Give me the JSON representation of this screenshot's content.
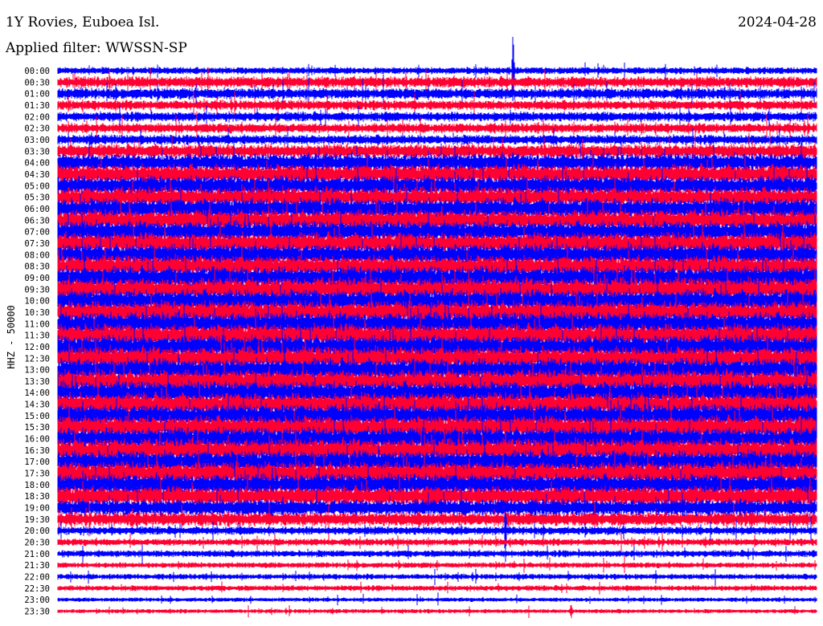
{
  "header": {
    "station": "1Y Rovies, Euboea Isl.",
    "filter": "Applied filter: WWSSN-SP",
    "date": "2024-04-28"
  },
  "chart_data": {
    "type": "line",
    "title": "1Y Rovies, Euboea Isl.",
    "subtitle": "Applied filter: WWSSN-SP",
    "ylabel": "HHZ - 50000",
    "xlabel": "",
    "x_minutes_per_line": 30,
    "colors": [
      "#0000ff",
      "#ff0033"
    ],
    "rows": [
      {
        "label": "00:00",
        "amp": 5
      },
      {
        "label": "00:30",
        "amp": 8
      },
      {
        "label": "01:00",
        "amp": 8
      },
      {
        "label": "01:30",
        "amp": 7
      },
      {
        "label": "02:00",
        "amp": 7
      },
      {
        "label": "02:30",
        "amp": 7
      },
      {
        "label": "03:00",
        "amp": 7
      },
      {
        "label": "03:30",
        "amp": 10
      },
      {
        "label": "04:00",
        "amp": 13
      },
      {
        "label": "04:30",
        "amp": 14
      },
      {
        "label": "05:00",
        "amp": 14
      },
      {
        "label": "05:30",
        "amp": 14
      },
      {
        "label": "06:00",
        "amp": 15
      },
      {
        "label": "06:30",
        "amp": 15
      },
      {
        "label": "07:00",
        "amp": 15
      },
      {
        "label": "07:30",
        "amp": 15
      },
      {
        "label": "08:00",
        "amp": 15
      },
      {
        "label": "08:30",
        "amp": 15
      },
      {
        "label": "09:00",
        "amp": 16
      },
      {
        "label": "09:30",
        "amp": 16
      },
      {
        "label": "10:00",
        "amp": 16
      },
      {
        "label": "10:30",
        "amp": 16
      },
      {
        "label": "11:00",
        "amp": 16
      },
      {
        "label": "11:30",
        "amp": 16
      },
      {
        "label": "12:00",
        "amp": 16
      },
      {
        "label": "12:30",
        "amp": 16
      },
      {
        "label": "13:00",
        "amp": 16
      },
      {
        "label": "13:30",
        "amp": 16
      },
      {
        "label": "14:00",
        "amp": 16
      },
      {
        "label": "14:30",
        "amp": 16
      },
      {
        "label": "15:00",
        "amp": 16
      },
      {
        "label": "15:30",
        "amp": 16
      },
      {
        "label": "16:00",
        "amp": 16
      },
      {
        "label": "16:30",
        "amp": 16
      },
      {
        "label": "17:00",
        "amp": 16
      },
      {
        "label": "17:30",
        "amp": 16
      },
      {
        "label": "18:00",
        "amp": 15
      },
      {
        "label": "18:30",
        "amp": 14
      },
      {
        "label": "19:00",
        "amp": 12
      },
      {
        "label": "19:30",
        "amp": 10
      },
      {
        "label": "20:00",
        "amp": 6
      },
      {
        "label": "20:30",
        "amp": 5
      },
      {
        "label": "21:00",
        "amp": 5
      },
      {
        "label": "21:30",
        "amp": 4
      },
      {
        "label": "22:00",
        "amp": 4
      },
      {
        "label": "22:30",
        "amp": 4
      },
      {
        "label": "23:00",
        "amp": 3
      },
      {
        "label": "23:30",
        "amp": 3
      }
    ],
    "events": [
      {
        "row": "00:00",
        "minute": 18.0,
        "amp": 60
      },
      {
        "row": "20:00",
        "minute": 17.7,
        "amp": 40
      },
      {
        "row": "23:30",
        "minute": 20.3,
        "amp": 14
      }
    ]
  }
}
